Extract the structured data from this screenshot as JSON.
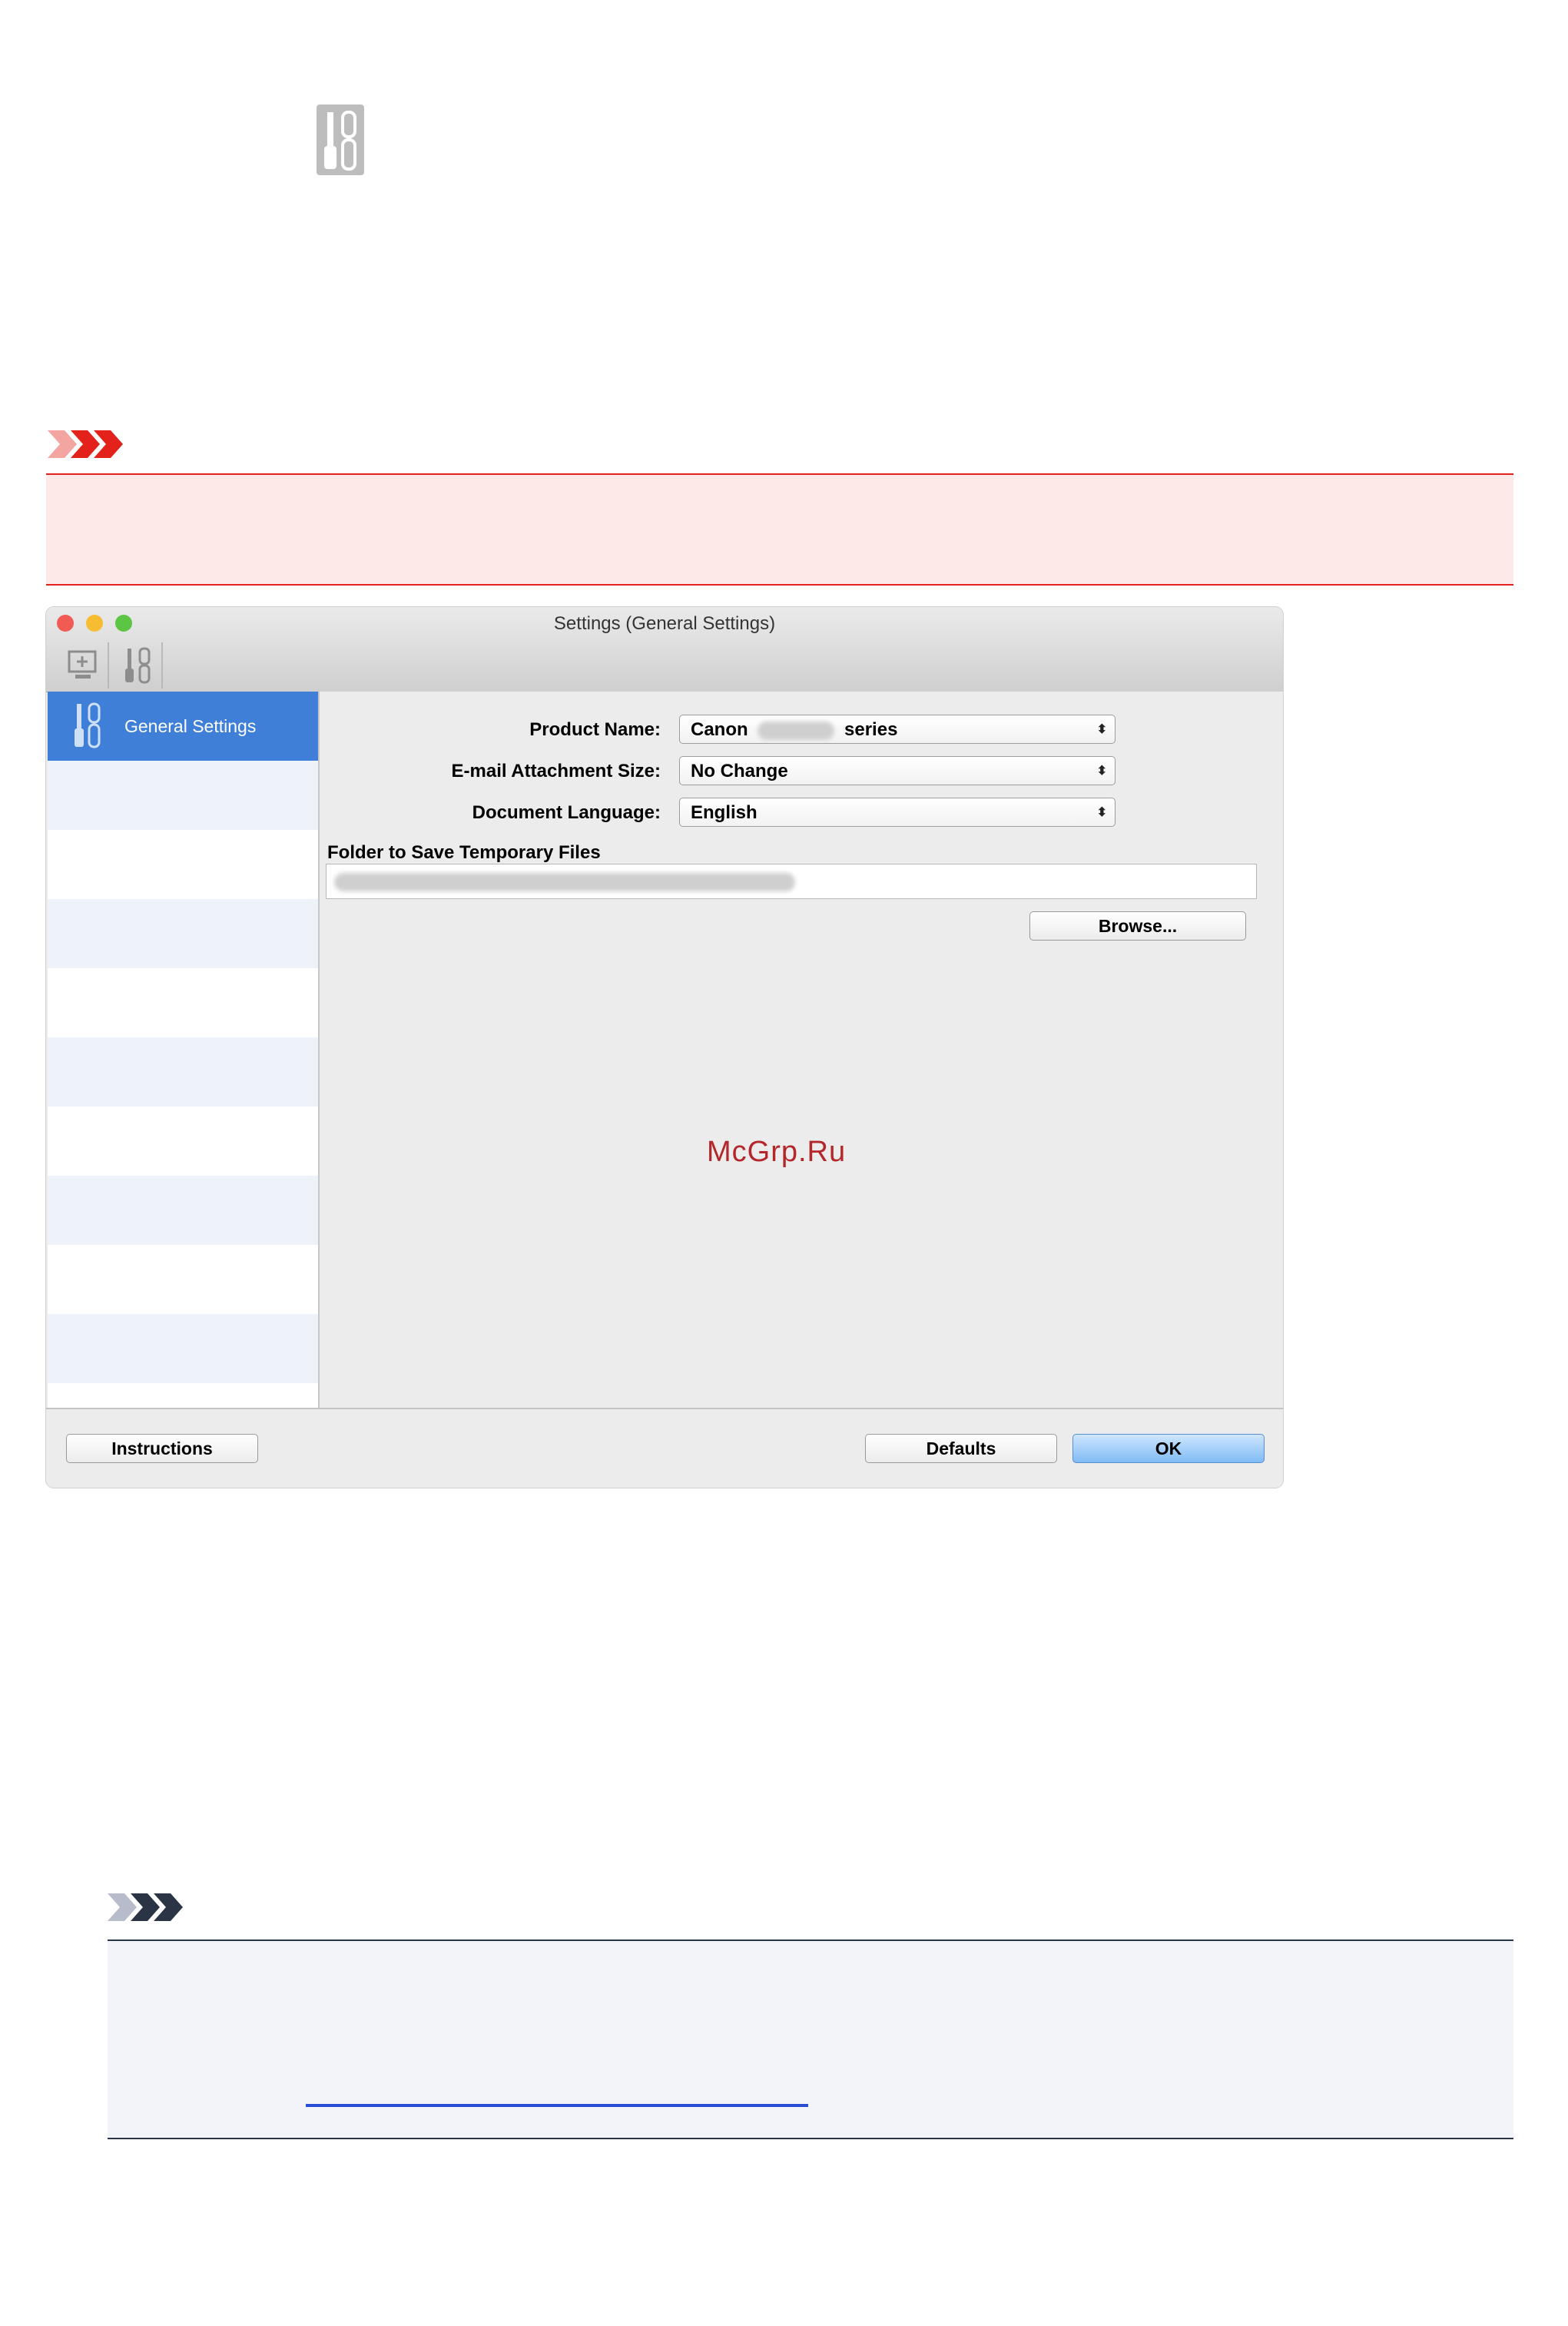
{
  "top_icon": {
    "icon": "tools-icon"
  },
  "important": {
    "icon": "important-arrows-icon",
    "color": "#e2221b",
    "background": "#fde9e8"
  },
  "window": {
    "title": "Settings (General Settings)",
    "toolbar": [
      {
        "icon": "scan-settings-icon"
      },
      {
        "icon": "general-settings-icon"
      }
    ],
    "sidebar": {
      "selected_label": "General Settings",
      "selected_icon": "tools-icon",
      "accent": "#3f7fd8"
    },
    "fields": {
      "product_name": {
        "label": "Product Name:",
        "value_prefix": "Canon",
        "value_suffix": "series"
      },
      "email_size": {
        "label": "E-mail Attachment Size:",
        "value": "No Change"
      },
      "doc_language": {
        "label": "Document Language:",
        "value": "English"
      }
    },
    "folder": {
      "label": "Folder to Save Temporary Files"
    },
    "browse_label": "Browse...",
    "instructions_label": "Instructions",
    "defaults_label": "Defaults",
    "ok_label": "OK"
  },
  "watermark": "McGrp.Ru",
  "note": {
    "icon": "note-arrows-icon",
    "color": "#2b3445",
    "background": "#f3f4f9"
  }
}
